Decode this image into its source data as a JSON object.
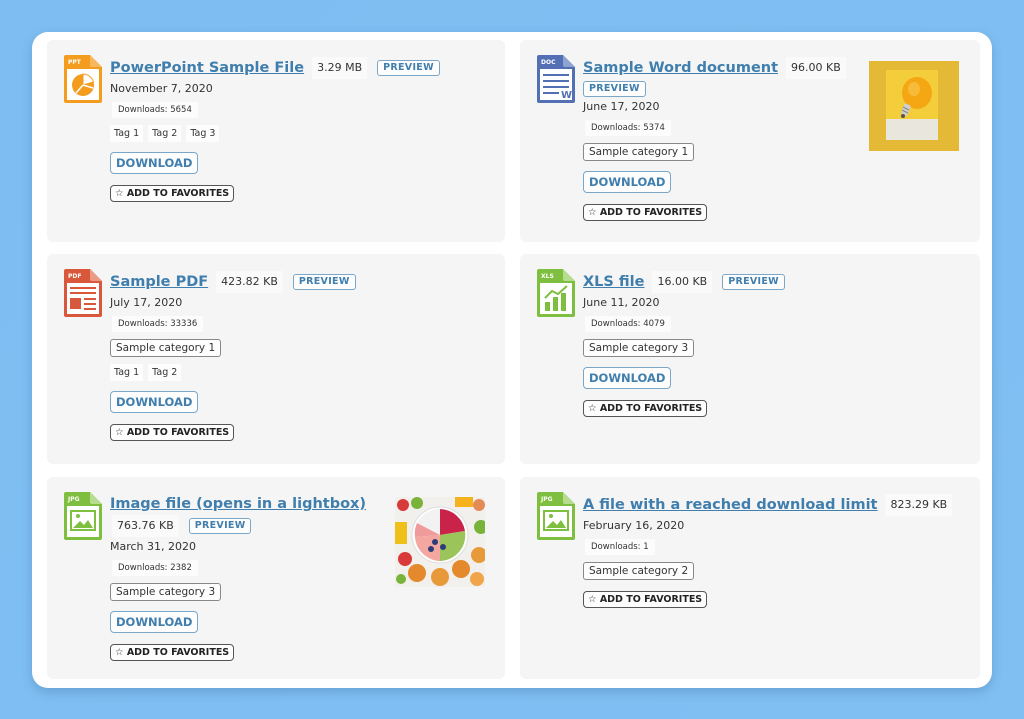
{
  "colors": {
    "background": "#7dbdf1",
    "link": "#3f7ead",
    "ppt": "#f39c1e",
    "doc": "#5470b4",
    "pdf": "#d9573a",
    "xls": "#7fbf3f",
    "jpg": "#7fbf3f"
  },
  "labels": {
    "preview": "PREVIEW",
    "download": "DOWNLOAD",
    "add_to_favorites": "☆ ADD TO FAVORITES"
  },
  "files": [
    {
      "icon": "ppt-file-icon",
      "icon_label": "PPT",
      "title": "PowerPoint Sample File",
      "size": "3.29 MB",
      "date": "November 7, 2020",
      "downloads": "Downloads: 5654",
      "tags": [
        "Tag 1",
        "Tag 2",
        "Tag 3"
      ]
    },
    {
      "icon": "doc-file-icon",
      "icon_label": "DOC",
      "title": "Sample Word document",
      "size": "96.00 KB",
      "date": "June 17, 2020",
      "downloads": "Downloads: 5374",
      "category": "Sample category 1",
      "thumbnail": "lightbulb-thumbnail"
    },
    {
      "icon": "pdf-file-icon",
      "icon_label": "PDF",
      "title": "Sample PDF",
      "size": "423.82 KB",
      "date": "July 17, 2020",
      "downloads": "Downloads: 33336",
      "category": "Sample category 1",
      "tags": [
        "Tag 1",
        "Tag 2"
      ]
    },
    {
      "icon": "xls-file-icon",
      "icon_label": "XLS",
      "title": "XLS file",
      "size": "16.00 KB",
      "date": "June 11, 2020",
      "downloads": "Downloads: 4079",
      "category": "Sample category 3"
    },
    {
      "icon": "jpg-file-icon",
      "icon_label": "JPG",
      "title": "Image file (opens in a lightbox)",
      "size": "763.76 KB",
      "date": "March 31, 2020",
      "downloads": "Downloads: 2382",
      "category": "Sample category 3",
      "thumbnail": "food-bowl-thumbnail"
    },
    {
      "icon": "jpg-file-icon",
      "icon_label": "JPG",
      "title": "A file with a reached download limit",
      "size": "823.29 KB",
      "date": "February 16, 2020",
      "downloads": "Downloads: 1",
      "category": "Sample category 2"
    }
  ]
}
